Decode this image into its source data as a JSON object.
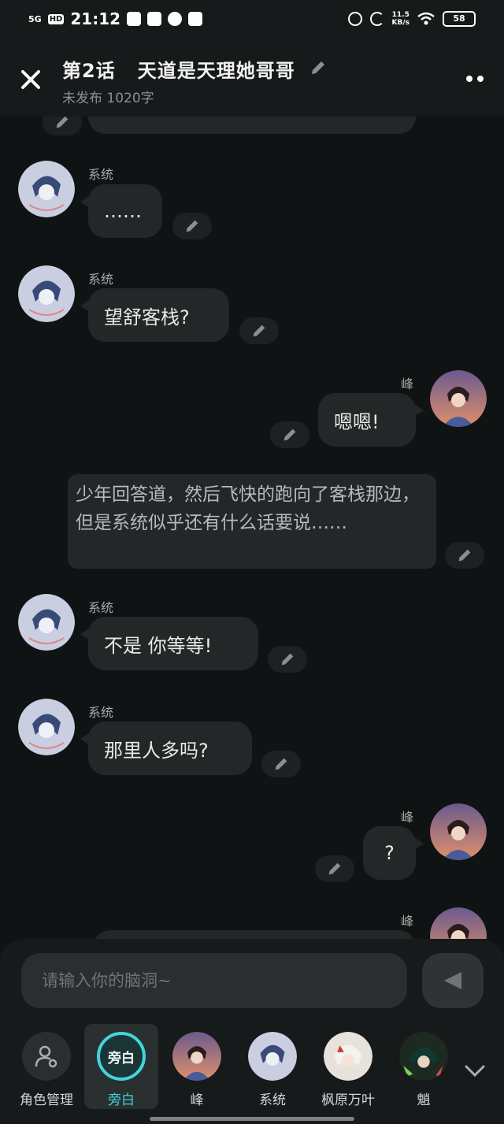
{
  "status_bar": {
    "network": "5G",
    "hd": "HD",
    "time": "21:12",
    "speed_value": "11.5",
    "speed_unit": "KB/s",
    "battery": "58"
  },
  "header": {
    "title": "第2话   天道是天理她哥哥",
    "subtitle": "未发布 1020字"
  },
  "messages": [
    {
      "speaker": "系统",
      "text": "……",
      "side": "left"
    },
    {
      "speaker": "系统",
      "text": "望舒客栈?",
      "side": "left"
    },
    {
      "speaker": "峰",
      "text": "嗯嗯!",
      "side": "right"
    },
    {
      "speaker": "",
      "text": "少年回答道，然后飞快的跑向了客栈那边，但是系统似乎还有什么话要说……",
      "side": "narration"
    },
    {
      "speaker": "系统",
      "text": "不是 你等等!",
      "side": "left"
    },
    {
      "speaker": "系统",
      "text": "那里人多吗?",
      "side": "left"
    },
    {
      "speaker": "峰",
      "text": "?",
      "side": "right"
    },
    {
      "speaker": "峰",
      "text": "",
      "side": "right"
    }
  ],
  "composer": {
    "placeholder": "请输入你的脑洞~"
  },
  "characters": [
    {
      "label": "角色管理",
      "icon": "user-settings-icon"
    },
    {
      "label": "旁白",
      "badge": "旁白",
      "active": true
    },
    {
      "label": "峰"
    },
    {
      "label": "系统"
    },
    {
      "label": "枫原万叶"
    },
    {
      "label": "魈"
    }
  ],
  "colors": {
    "background": "#101313",
    "bubble": "#232727",
    "accent": "#40d6db"
  }
}
